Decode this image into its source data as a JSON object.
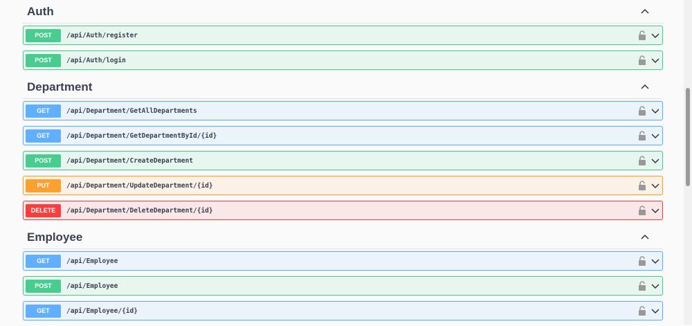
{
  "sections": [
    {
      "title": "Auth",
      "ops": [
        {
          "method": "POST",
          "path": "/api/Auth/register"
        },
        {
          "method": "POST",
          "path": "/api/Auth/login"
        }
      ]
    },
    {
      "title": "Department",
      "ops": [
        {
          "method": "GET",
          "path": "/api/Department/GetAllDepartments"
        },
        {
          "method": "GET",
          "path": "/api/Department/GetDepartmentById/{id}"
        },
        {
          "method": "POST",
          "path": "/api/Department/CreateDepartment"
        },
        {
          "method": "PUT",
          "path": "/api/Department/UpdateDepartment/{id}"
        },
        {
          "method": "DELETE",
          "path": "/api/Department/DeleteDepartment/{id}"
        }
      ]
    },
    {
      "title": "Employee",
      "ops": [
        {
          "method": "GET",
          "path": "/api/Employee"
        },
        {
          "method": "POST",
          "path": "/api/Employee"
        },
        {
          "method": "GET",
          "path": "/api/Employee/{id}"
        }
      ]
    }
  ]
}
